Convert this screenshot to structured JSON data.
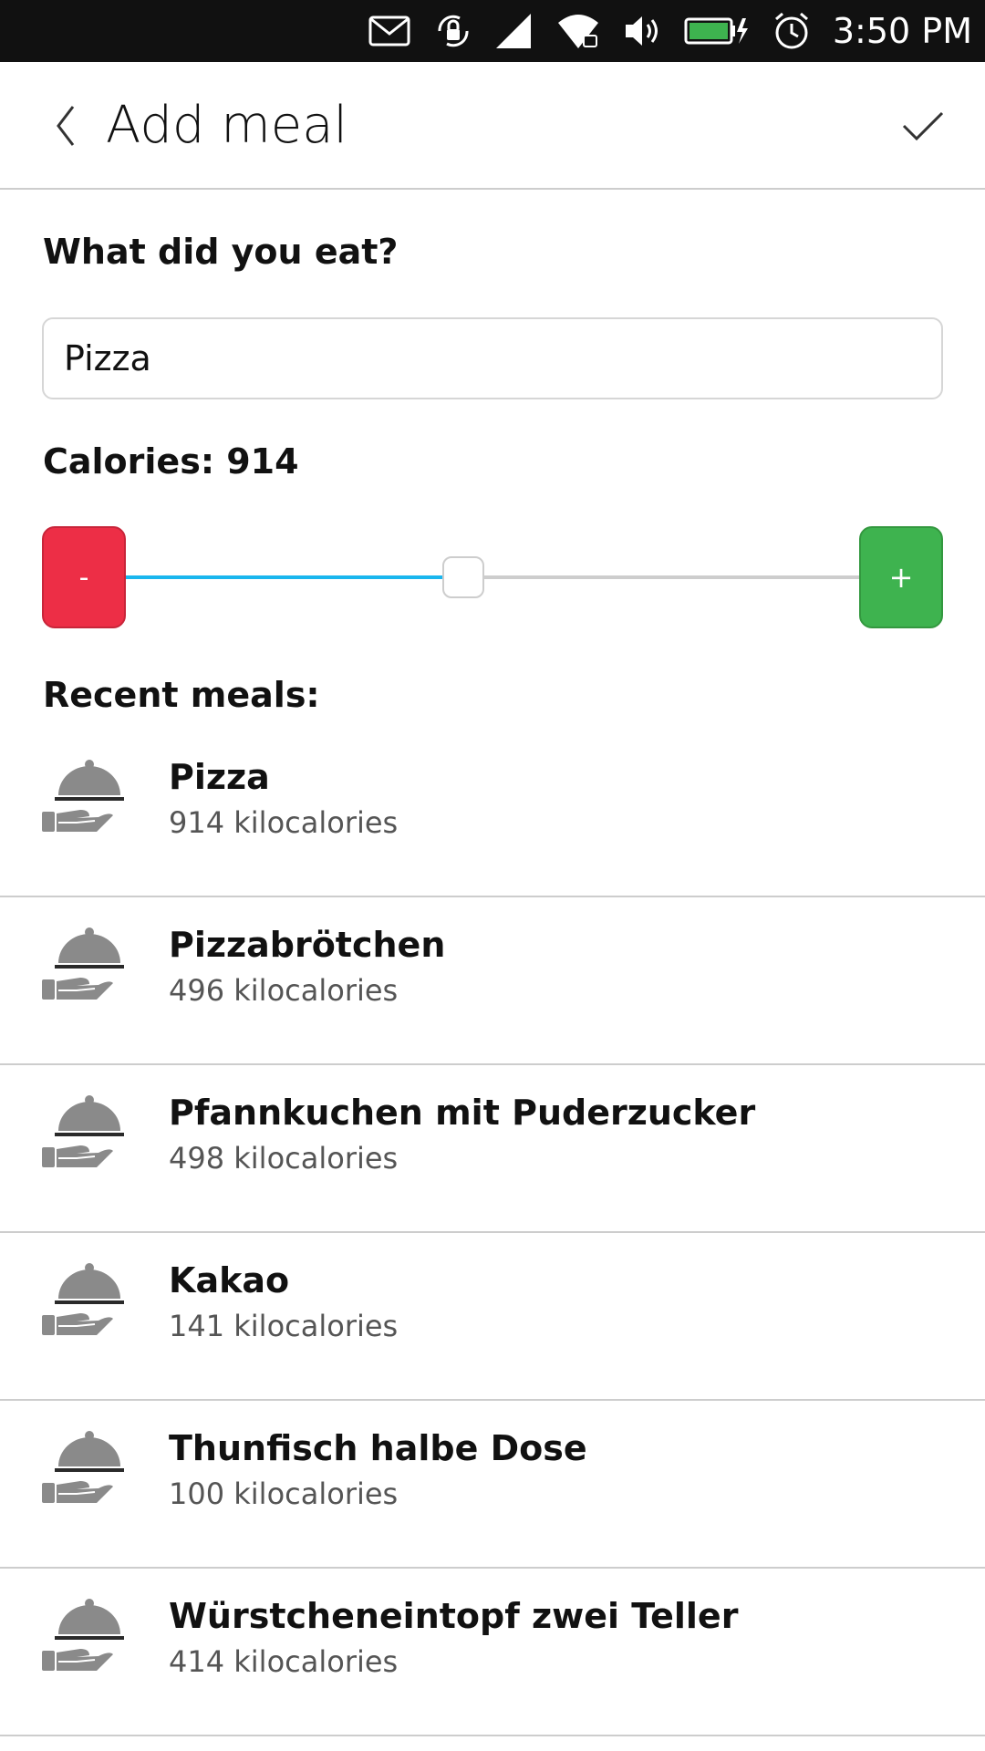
{
  "status_bar": {
    "time": "3:50 PM",
    "icons": [
      "mail-icon",
      "rotation-lock-icon",
      "signal-icon",
      "wifi-icon",
      "volume-icon",
      "battery-charging-icon",
      "alarm-icon"
    ],
    "battery_color": "#3eb34f"
  },
  "header": {
    "title": "Add meal",
    "back_icon": "chevron-left-icon",
    "confirm_icon": "checkmark-icon"
  },
  "form": {
    "question_label": "What did you eat?",
    "meal_input_value": "Pizza",
    "calories_label": "Calories: 914",
    "minus_label": "-",
    "plus_label": "+",
    "slider_fraction": 0.46,
    "colors": {
      "minus": "#ed2e46",
      "plus": "#3eb34f",
      "slider_fill": "#19b6ee"
    }
  },
  "recent": {
    "label": "Recent meals:",
    "item_icon": "cloche-serving-hand-icon",
    "items": [
      {
        "name": "Pizza",
        "calories": "914 kilocalories"
      },
      {
        "name": "Pizzabrötchen",
        "calories": "496 kilocalories"
      },
      {
        "name": "Pfannkuchen mit Puderzucker",
        "calories": "498 kilocalories"
      },
      {
        "name": "Kakao",
        "calories": "141 kilocalories"
      },
      {
        "name": "Thunfisch halbe Dose",
        "calories": "100 kilocalories"
      },
      {
        "name": "Würstcheneintopf zwei Teller",
        "calories": "414 kilocalories"
      }
    ]
  }
}
